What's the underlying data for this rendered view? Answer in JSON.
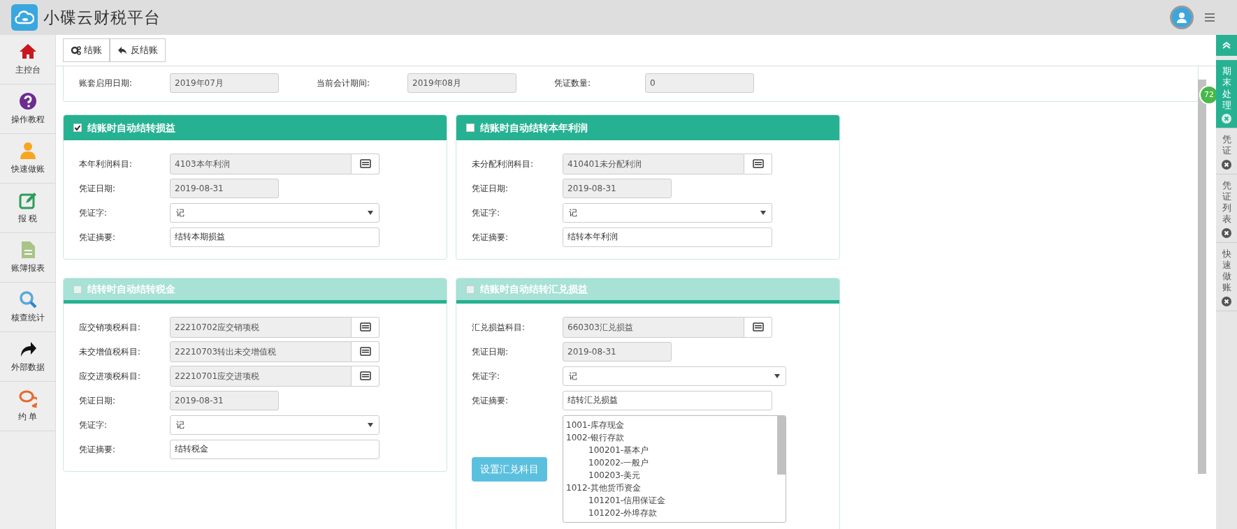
{
  "app": {
    "title": "小碟云财税平台"
  },
  "sidebar": {
    "items": [
      {
        "label": "主控台",
        "kind": "home"
      },
      {
        "label": "操作教程",
        "kind": "help"
      },
      {
        "label": "快速做账",
        "kind": "user"
      },
      {
        "label": "报 税",
        "kind": "edit"
      },
      {
        "label": "账簿报表",
        "kind": "document"
      },
      {
        "label": "核查统计",
        "kind": "search"
      },
      {
        "label": "外部数据",
        "kind": "share"
      },
      {
        "label": "约 单",
        "kind": "chat"
      }
    ]
  },
  "toolbar": {
    "buttons": [
      {
        "label": "结账",
        "kind": "gears"
      },
      {
        "label": "反结账",
        "kind": "undo"
      }
    ]
  },
  "info": {
    "fields": [
      {
        "label": "账套启用日期:",
        "value": "2019年07月"
      },
      {
        "label": "当前会计期间:",
        "value": "2019年08月"
      },
      {
        "label": "凭证数量:",
        "value": "0"
      }
    ]
  },
  "panels": [
    {
      "title": "结账时自动结转损益",
      "checked": true,
      "dimmed": false,
      "fields": [
        {
          "kind": "lookup",
          "label": "本年利润科目:",
          "value": "4103本年利润"
        },
        {
          "kind": "date",
          "label": "凭证日期:",
          "value": "2019-08-31"
        },
        {
          "kind": "select",
          "label": "凭证字:",
          "value": "记"
        },
        {
          "kind": "text",
          "label": "凭证摘要:",
          "value": "结转本期损益"
        }
      ]
    },
    {
      "title": "结账时自动结转本年利润",
      "checked": false,
      "dimmed": false,
      "fields": [
        {
          "kind": "lookup",
          "label": "未分配利润科目:",
          "value": "410401未分配利润"
        },
        {
          "kind": "date",
          "label": "凭证日期:",
          "value": "2019-08-31"
        },
        {
          "kind": "select",
          "label": "凭证字:",
          "value": "记"
        },
        {
          "kind": "text",
          "label": "凭证摘要:",
          "value": "结转本年利润"
        }
      ]
    },
    {
      "title": "结转时自动结转税金",
      "checked": false,
      "dimmed": true,
      "fields": [
        {
          "kind": "lookup",
          "label": "应交销项税科目:",
          "value": "22210702应交销项税"
        },
        {
          "kind": "lookup",
          "label": "未交增值税科目:",
          "value": "22210703转出未交增值税"
        },
        {
          "kind": "lookup",
          "label": "应交进项税科目:",
          "value": "22210701应交进项税"
        },
        {
          "kind": "date",
          "label": "凭证日期:",
          "value": "2019-08-31"
        },
        {
          "kind": "select",
          "label": "凭证字:",
          "value": "记"
        },
        {
          "kind": "text",
          "label": "凭证摘要:",
          "value": "结转税金"
        }
      ]
    },
    {
      "title": "结账时自动结转汇兑损益",
      "checked": false,
      "dimmed": true,
      "fields": [
        {
          "kind": "lookup",
          "label": "汇兑损益科目:",
          "value": "660303汇兑损益"
        },
        {
          "kind": "date",
          "label": "凭证日期:",
          "value": "2019-08-31"
        },
        {
          "kind": "select",
          "label": "凭证字:",
          "value": "记"
        },
        {
          "kind": "text",
          "label": "凭证摘要:",
          "value": "结转汇兑损益"
        }
      ],
      "button": "设置汇兑科目",
      "accounts": [
        {
          "label": "1001-库存现金"
        },
        {
          "label": "1002-银行存款",
          "children": [
            {
              "label": "100201-基本户"
            },
            {
              "label": "100202-一般户"
            },
            {
              "label": "100203-美元"
            }
          ]
        },
        {
          "label": "1012-其他货币资金",
          "children": [
            {
              "label": "101201-信用保证金"
            },
            {
              "label": "101202-外埠存款"
            }
          ]
        }
      ]
    }
  ],
  "side_tabs": [
    {
      "label": "期末处理",
      "selected": true,
      "badge": "72"
    },
    {
      "label": "凭证",
      "selected": false
    },
    {
      "label": "凭证列表",
      "selected": false
    },
    {
      "label": "快速做账",
      "selected": false
    }
  ]
}
